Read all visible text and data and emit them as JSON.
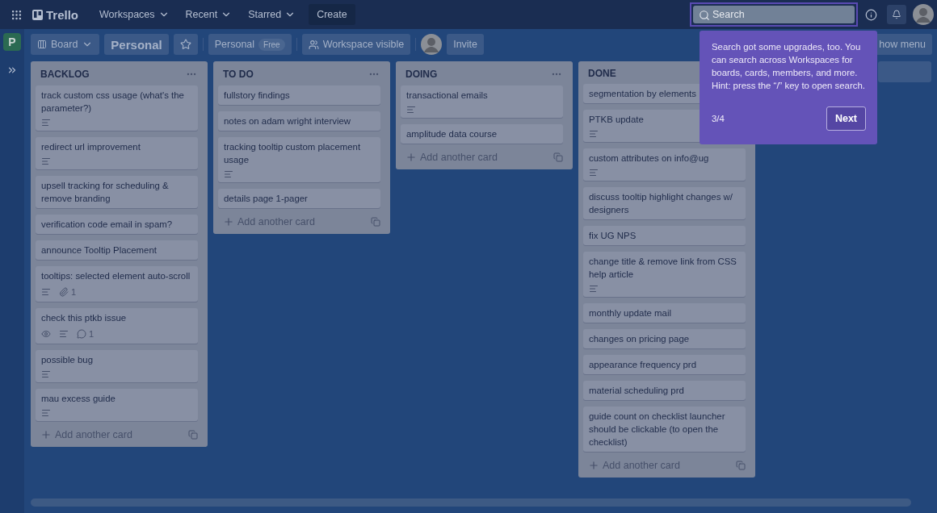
{
  "top_bar": {
    "logo": "Trello",
    "menus": [
      {
        "label": "Workspaces"
      },
      {
        "label": "Recent"
      },
      {
        "label": "Starred"
      }
    ],
    "create": "Create",
    "search": {
      "placeholder": "Search"
    }
  },
  "sidebar": {
    "workspace_initial": "P"
  },
  "board_header": {
    "view": "Board",
    "title": "Personal",
    "workspace": "Personal",
    "plan": "Free",
    "visibility": "Workspace visible",
    "invite": "Invite",
    "menu": "how menu"
  },
  "lists": [
    {
      "title": "BACKLOG",
      "menu_shown": true,
      "add": "Add another card",
      "cards": [
        {
          "title": "track custom css usage (what's the parameter?)",
          "badges": [
            {
              "kind": "description"
            }
          ]
        },
        {
          "title": "redirect url improvement",
          "badges": [
            {
              "kind": "description"
            }
          ]
        },
        {
          "title": "upsell tracking for scheduling & remove branding"
        },
        {
          "title": "verification code email in spam?"
        },
        {
          "title": "announce Tooltip Placement"
        },
        {
          "title": "tooltips: selected element auto-scroll",
          "badges": [
            {
              "kind": "description"
            },
            {
              "kind": "attachment",
              "count": "1"
            }
          ]
        },
        {
          "title": "check this ptkb issue",
          "badges": [
            {
              "kind": "watch"
            },
            {
              "kind": "description"
            },
            {
              "kind": "comment",
              "count": "1"
            }
          ]
        },
        {
          "title": "possible bug",
          "badges": [
            {
              "kind": "description"
            }
          ]
        },
        {
          "title": "mau excess guide",
          "badges": [
            {
              "kind": "description"
            }
          ]
        }
      ]
    },
    {
      "title": "TO DO",
      "menu_shown": true,
      "add": "Add another card",
      "cards": [
        {
          "title": "fullstory findings"
        },
        {
          "title": "notes on adam wright interview"
        },
        {
          "title": "tracking tooltip custom placement usage",
          "badges": [
            {
              "kind": "description"
            }
          ]
        },
        {
          "title": "details page 1-pager"
        }
      ]
    },
    {
      "title": "DOING",
      "menu_shown": true,
      "add": "Add another card",
      "cards": [
        {
          "title": "transactional emails",
          "badges": [
            {
              "kind": "description"
            }
          ]
        },
        {
          "title": "amplitude data course"
        }
      ]
    },
    {
      "title": "DONE",
      "menu_shown": false,
      "add": "Add another card",
      "cards": [
        {
          "title": "segmentation by elements"
        },
        {
          "title": "PTKB update",
          "badges": [
            {
              "kind": "description"
            }
          ]
        },
        {
          "title": "custom attributes on info@ug",
          "badges": [
            {
              "kind": "description"
            }
          ]
        },
        {
          "title": "discuss tooltip highlight changes w/ designers"
        },
        {
          "title": "fix UG NPS"
        },
        {
          "title": "change title & remove link from CSS help article",
          "badges": [
            {
              "kind": "description"
            }
          ]
        },
        {
          "title": "monthly update mail"
        },
        {
          "title": "changes on pricing page"
        },
        {
          "title": "appearance frequency prd"
        },
        {
          "title": "material scheduling prd"
        },
        {
          "title": "guide count on checklist launcher should be clickable (to open the checklist)"
        }
      ]
    }
  ],
  "tour": {
    "text": "Search got some upgrades, too. You can search across Workspaces for boards, cards, members, and more. Hint: press the “/” key to open search.",
    "step": "3/4",
    "next": "Next"
  }
}
